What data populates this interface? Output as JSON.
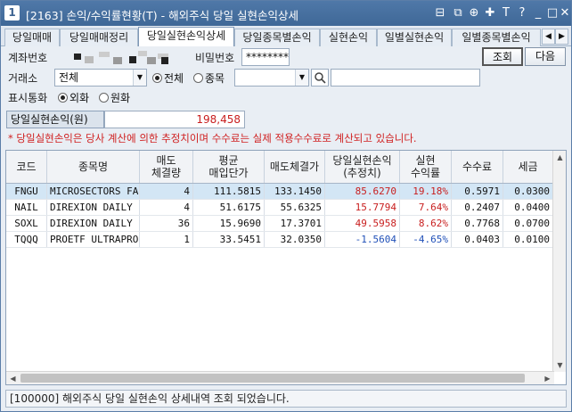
{
  "window": {
    "title": "[2163] 손익/수익률현황(T) - 해외주식 당일 실현손익상세",
    "icon_label": "1",
    "controls": [
      "⊟",
      "⧉",
      "⊕",
      "✚",
      "T",
      "?",
      "_",
      "□",
      "✕"
    ]
  },
  "tabs": [
    {
      "label": "당일매매"
    },
    {
      "label": "당일매매정리"
    },
    {
      "label": "당일실현손익상세"
    },
    {
      "label": "당일종목별손익"
    },
    {
      "label": "실현손익"
    },
    {
      "label": "일별실현손익"
    },
    {
      "label": "일별종목별손익"
    }
  ],
  "tab_nav": {
    "prev": "◀",
    "next": "▶"
  },
  "form": {
    "account_label": "계좌번호",
    "password_label": "비밀번호",
    "password_value": "*********",
    "query_button": "조회",
    "next_button": "다음",
    "exchange_label": "거래소",
    "exchange_value": "전체",
    "radio_all": "전체",
    "radio_stock": "종목",
    "currency_label": "표시통화",
    "radio_foreign": "외화",
    "radio_won": "원화"
  },
  "summary": {
    "label": "당일실현손익(원)",
    "value": "198,458",
    "notice": "* 당일실현손익은 당사 계산에 의한 추정치이며 수수료는 실제 적용수수료로 계산되고 있습니다."
  },
  "table": {
    "headers": [
      "코드",
      "종목명",
      "매도\n체결량",
      "평균\n매입단가",
      "매도체결가",
      "당일실현손익\n(추정치)",
      "실현\n수익률",
      "수수료",
      "세금"
    ],
    "rows": [
      {
        "code": "FNGU",
        "name": "MICROSECTORS FAN",
        "qty": "4",
        "avg_price": "111.5815",
        "sell_price": "133.1450",
        "pnl": "85.6270",
        "rate": "19.18%",
        "fee": "0.5971",
        "tax": "0.0300"
      },
      {
        "code": "NAIL",
        "name": "DIREXION DAILY H",
        "qty": "4",
        "avg_price": "51.6175",
        "sell_price": "55.6325",
        "pnl": "15.7794",
        "rate": "7.64%",
        "fee": "0.2407",
        "tax": "0.0400"
      },
      {
        "code": "SOXL",
        "name": "DIREXION DAILY S",
        "qty": "36",
        "avg_price": "15.9690",
        "sell_price": "17.3701",
        "pnl": "49.5958",
        "rate": "8.62%",
        "fee": "0.7768",
        "tax": "0.0700"
      },
      {
        "code": "TQQQ",
        "name": "PROETF ULTRAPRO",
        "qty": "1",
        "avg_price": "33.5451",
        "sell_price": "32.0350",
        "pnl": "-1.5604",
        "rate": "-4.65%",
        "fee": "0.0403",
        "tax": "0.0100"
      }
    ]
  },
  "status": {
    "message": "[100000] 해외주식 당일 실현손익 상세내역 조회 되었습니다."
  },
  "colors": {
    "title_bar": "#4a72a1",
    "positive": "#c81e1e",
    "negative": "#2050b8",
    "selected_row": "#d3e6f5",
    "notice": "#d02020"
  }
}
